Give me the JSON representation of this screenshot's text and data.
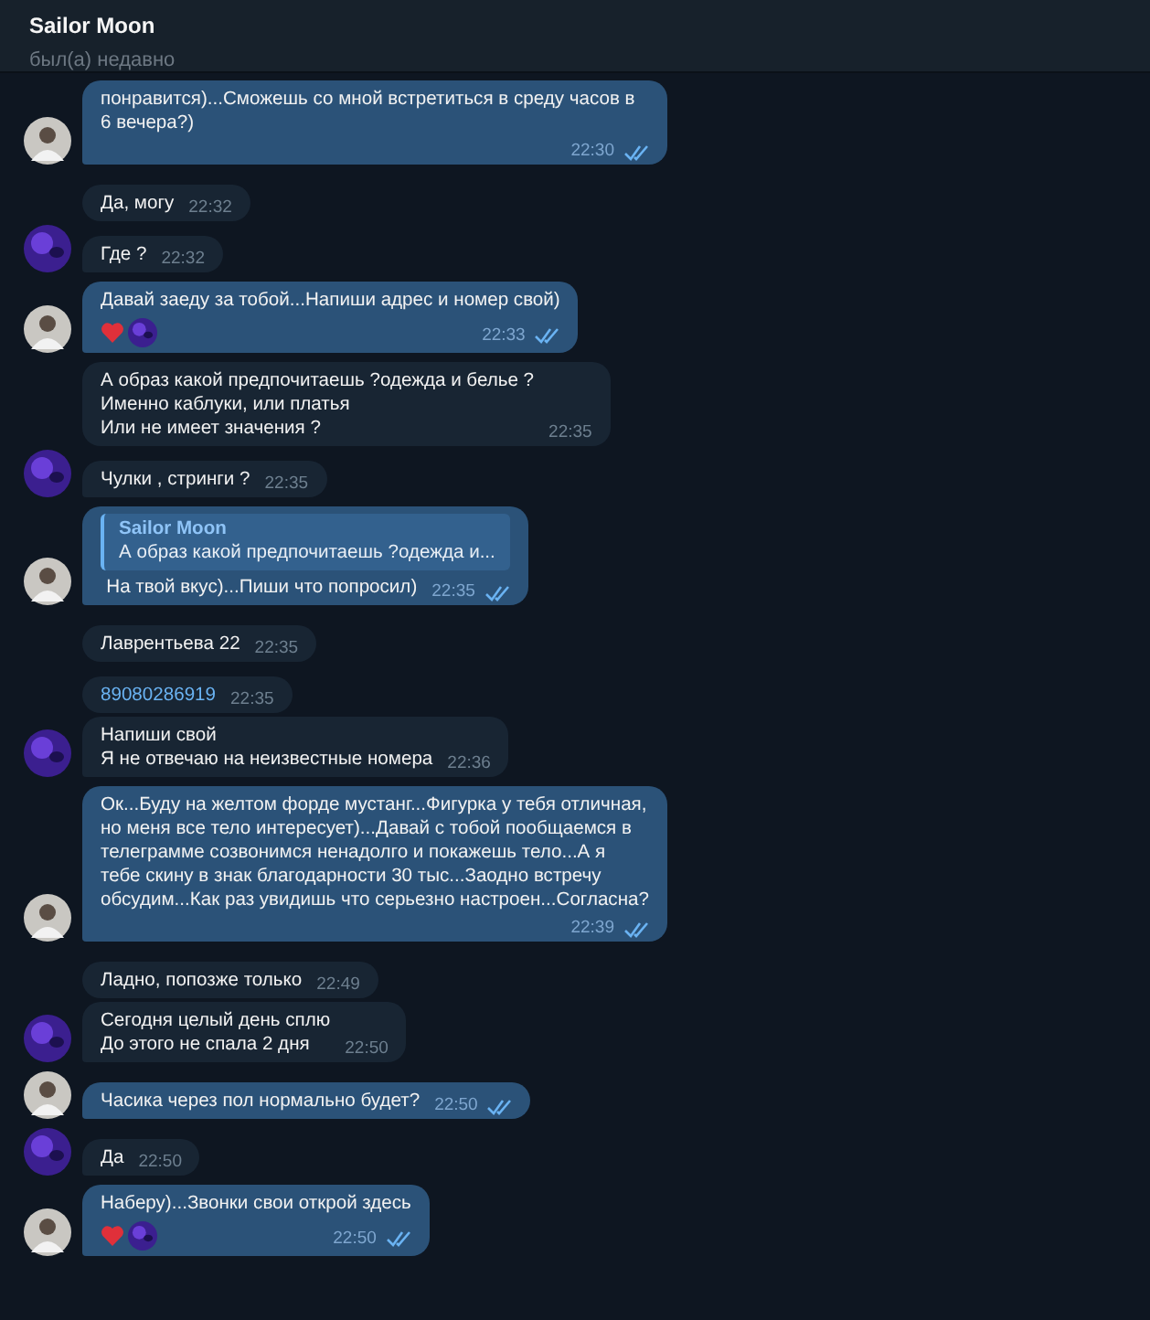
{
  "header": {
    "title": "Sailor Moon",
    "status": "был(а) недавно"
  },
  "messages": [
    {
      "outgoing": true,
      "kind": "text",
      "text": "понравится)...Сможешь со мной встретиться в среду часов в 6 вечера?)",
      "time": "22:30",
      "read": true,
      "avatar": true
    },
    {
      "outgoing": false,
      "kind": "text",
      "text": "Да, могу",
      "time": "22:32",
      "avatar": false
    },
    {
      "outgoing": false,
      "kind": "text",
      "text": "Где ?",
      "time": "22:32",
      "avatar": true
    },
    {
      "outgoing": true,
      "kind": "text",
      "text": "Давай заеду за тобой...Напиши адрес и номер свой)",
      "time": "22:33",
      "read": true,
      "avatar": true,
      "reactions": [
        {
          "kind": "heart"
        },
        {
          "kind": "avatar"
        }
      ]
    },
    {
      "outgoing": false,
      "kind": "text",
      "text": "А образ какой предпочитаешь ?одежда и белье ?\nИменно каблуки, или платья\nИли не имеет значения ?",
      "time": "22:35",
      "avatar": false
    },
    {
      "outgoing": false,
      "kind": "text",
      "text": "Чулки , стринги ?",
      "time": "22:35",
      "avatar": true
    },
    {
      "outgoing": true,
      "kind": "text",
      "reply": {
        "author": "Sailor Moon",
        "text": "А образ какой предпочитаешь ?одежда и..."
      },
      "text": "На твой вкус)...Пиши что попросил)",
      "time": "22:35",
      "read": true,
      "avatar": true
    },
    {
      "outgoing": false,
      "kind": "text",
      "text": "Лаврентьева 22",
      "time": "22:35",
      "avatar": false
    },
    {
      "outgoing": false,
      "kind": "phone",
      "text": "89080286919",
      "time": "22:35",
      "avatar": false
    },
    {
      "outgoing": false,
      "kind": "text",
      "text": "Напиши свой\nЯ не отвечаю на неизвестные номера",
      "time": "22:36",
      "avatar": true
    },
    {
      "outgoing": true,
      "kind": "text",
      "text": "Ок...Буду на желтом форде мустанг...Фигурка у тебя отличная, но меня все тело интересует)...Давай с тобой пообщаемся в телеграмме созвонимся ненадолго и покажешь тело...А я тебе скину в знак благодарности 30 тыс...Заодно встречу обсудим...Как раз увидишь что серьезно настроен...Согласна?",
      "time": "22:39",
      "read": true,
      "avatar": true
    },
    {
      "outgoing": false,
      "kind": "text",
      "text": "Ладно, попозже только",
      "time": "22:49",
      "avatar": false
    },
    {
      "outgoing": false,
      "kind": "text",
      "text": "Сегодня целый день сплю\nДо этого не спала 2 дня",
      "time": "22:50",
      "avatar": true
    },
    {
      "outgoing": true,
      "kind": "text",
      "text": "Часика через пол нормально будет?",
      "time": "22:50",
      "read": true,
      "avatar": true
    },
    {
      "outgoing": false,
      "kind": "text",
      "text": "Да",
      "time": "22:50",
      "avatar": true
    },
    {
      "outgoing": true,
      "kind": "text",
      "text": "Наберу)...Звонки свои открой здесь",
      "time": "22:50",
      "read": true,
      "avatar": true,
      "reactions": [
        {
          "kind": "heart"
        },
        {
          "kind": "avatar"
        }
      ]
    }
  ]
}
